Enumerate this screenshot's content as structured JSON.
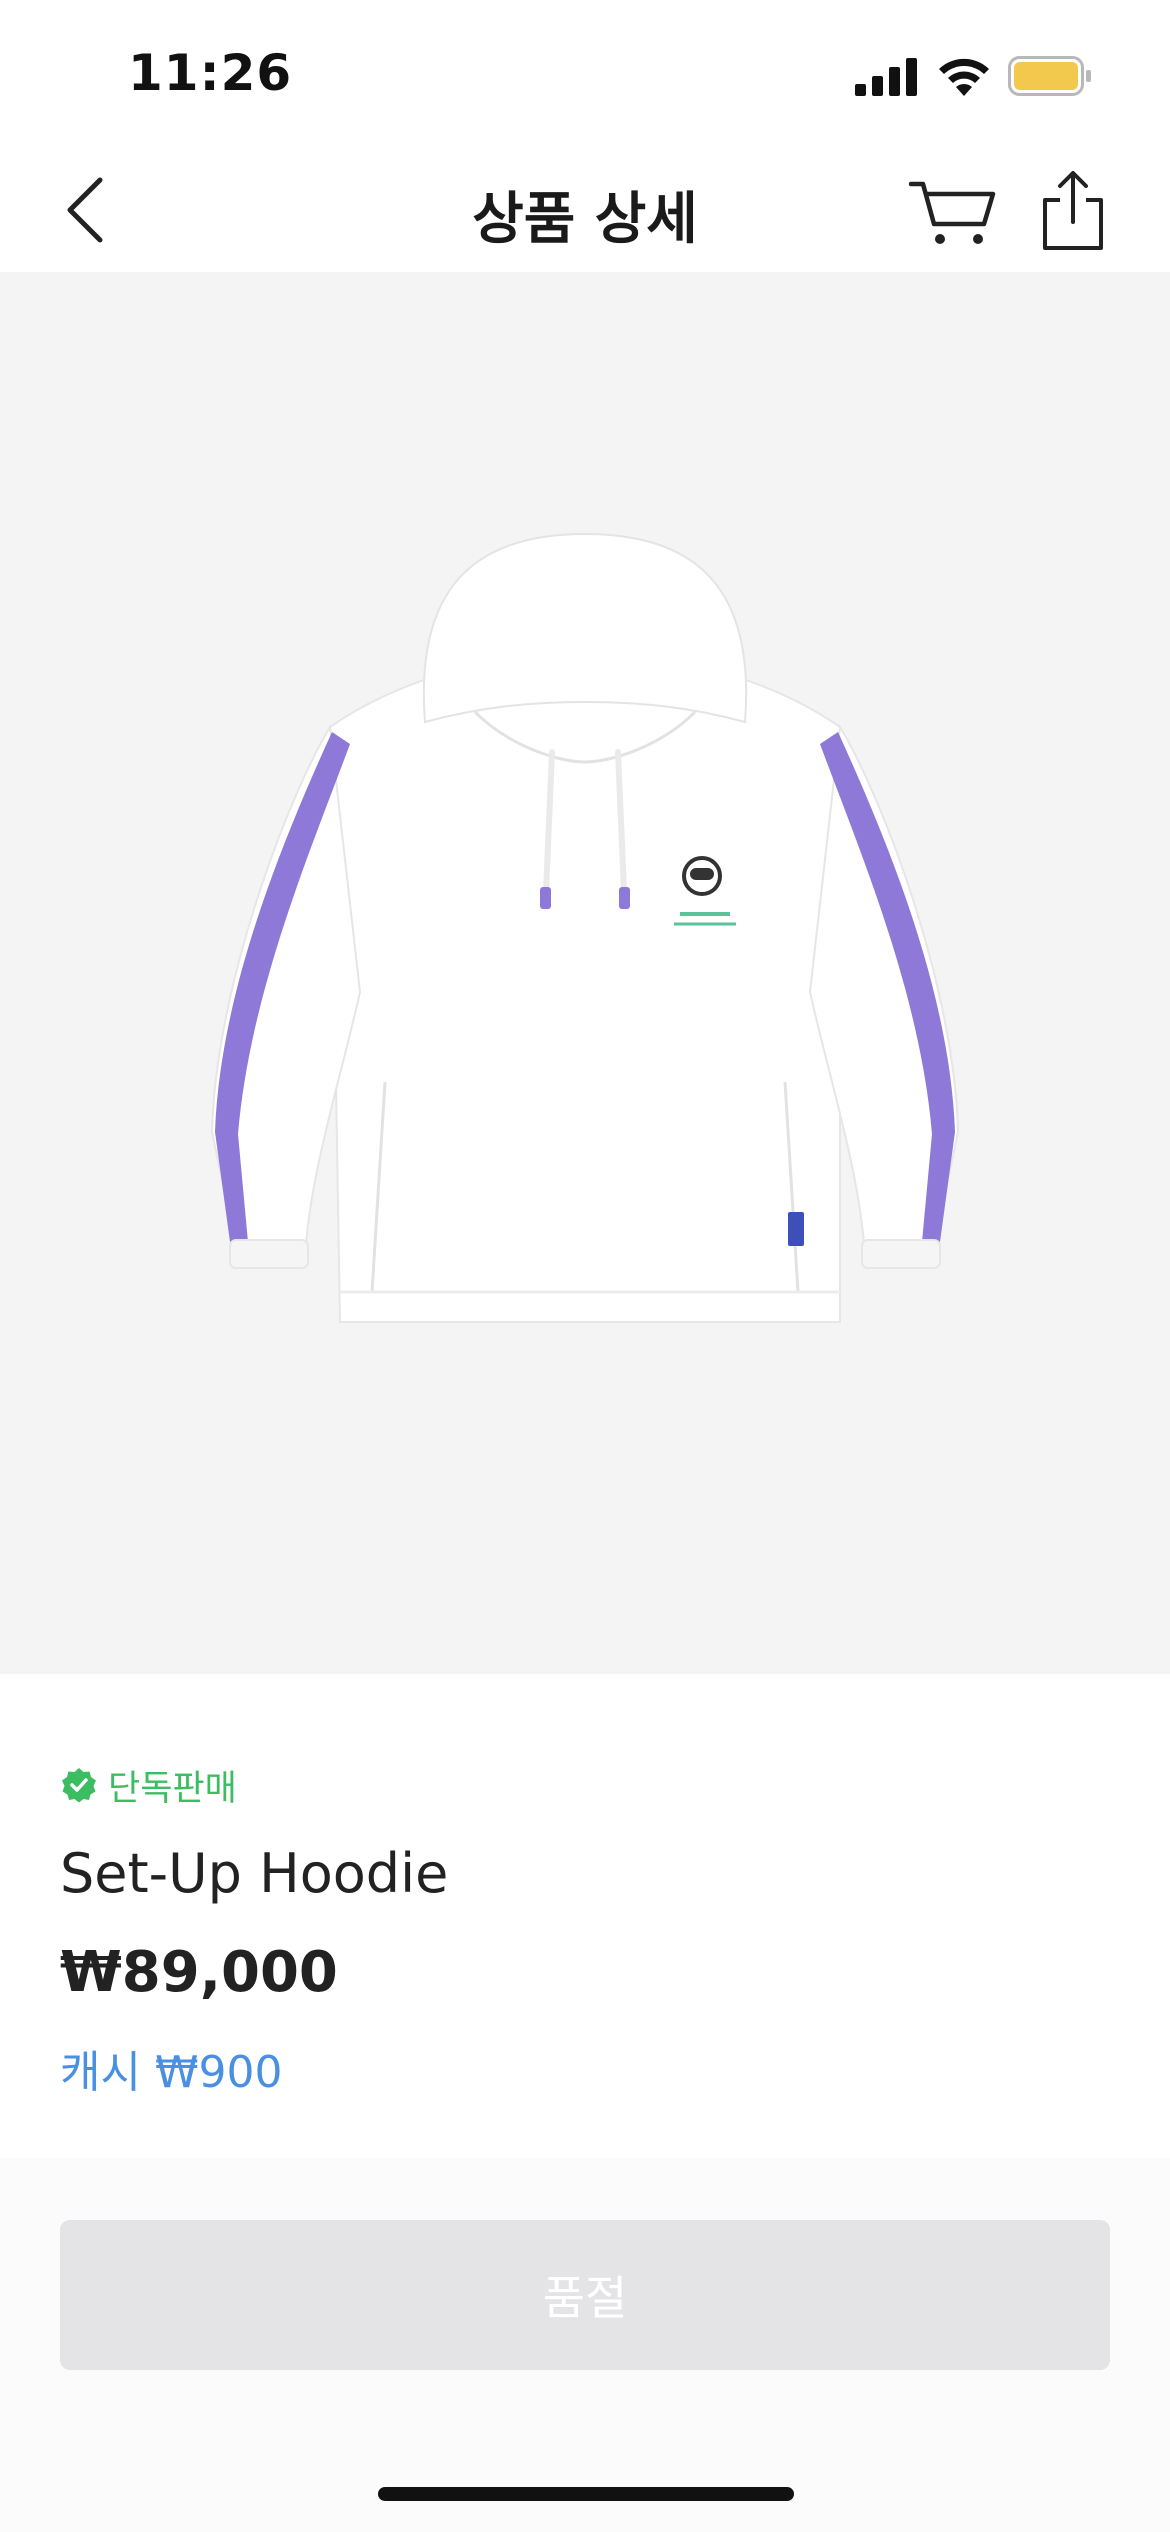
{
  "status_bar": {
    "time": "11:26",
    "icons": [
      "signal-icon",
      "wifi-icon",
      "battery-icon"
    ],
    "battery_color": "#f2c94c"
  },
  "nav": {
    "title": "상품 상세",
    "icons": [
      "back-chevron-icon",
      "cart-icon",
      "share-icon"
    ]
  },
  "product": {
    "image_icon": "hoodie-image",
    "badge": {
      "icon": "verified-check-icon",
      "label": "단독판매",
      "color": "#3dbd62"
    },
    "name": "Set-Up Hoodie",
    "price": "₩89,000",
    "cash": "캐시 ₩900",
    "cash_color": "#4a90e2"
  },
  "actions": {
    "buy_label": "품절",
    "buy_bg": "#e4e4e7"
  }
}
